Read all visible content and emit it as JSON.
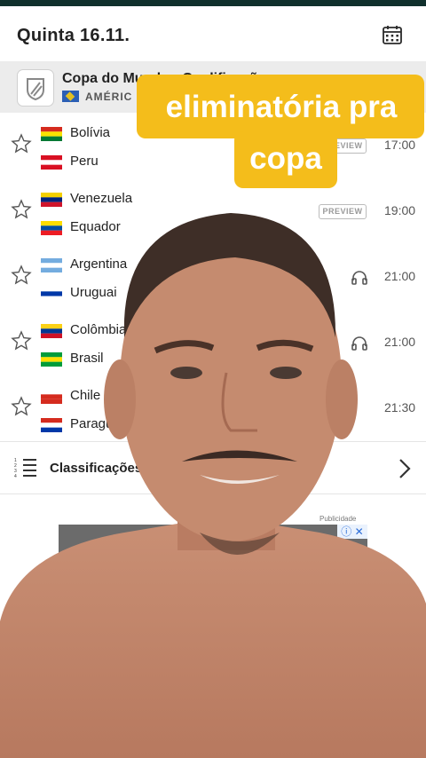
{
  "header": {
    "date": "Quinta 16.11.",
    "calendar_icon": "calendar-icon"
  },
  "competition": {
    "name": "Copa do Mundo · Qualificação",
    "region": "AMÉRIC"
  },
  "matches": [
    {
      "home": "Bolívia",
      "away": "Peru",
      "time": "17:00",
      "badge": "PREVIEW",
      "home_flag": [
        "#d52b1e",
        "#f9e300",
        "#007934"
      ],
      "away_flag": [
        "#d91023",
        "#ffffff",
        "#d91023"
      ]
    },
    {
      "home": "Venezuela",
      "away": "Equador",
      "time": "19:00",
      "badge": "PREVIEW",
      "home_flag": [
        "#f4d000",
        "#00247d",
        "#cf142b"
      ],
      "away_flag": [
        "#ffdd00",
        "#034ea2",
        "#ed1c24"
      ]
    },
    {
      "home": "Argentina",
      "away": "Uruguai",
      "time": "21:00",
      "badge": "headphones",
      "home_flag": [
        "#74acdf",
        "#ffffff",
        "#74acdf"
      ],
      "away_flag": [
        "#ffffff",
        "#0038a8",
        "#ffffff"
      ]
    },
    {
      "home": "Colômbia",
      "away": "Brasil",
      "time": "21:00",
      "badge": "headphones",
      "home_flag": [
        "#fcd116",
        "#003893",
        "#ce1126"
      ],
      "away_flag": [
        "#009c3b",
        "#ffdf00",
        "#009c3b"
      ]
    },
    {
      "home": "Chile",
      "away": "Paraguai",
      "time": "21:30",
      "badge": "",
      "home_flag": [
        "#ffffff",
        "#d52b1e",
        "#d52b1e"
      ],
      "away_flag": [
        "#d52b1e",
        "#ffffff",
        "#0038a8"
      ]
    }
  ],
  "standings": {
    "label": "Classificações"
  },
  "ad": {
    "label": "Publicidade",
    "badge": "ⓘ ✕"
  },
  "caption": {
    "line1": "eliminatória pra",
    "line2": "copa"
  },
  "colors": {
    "accent": "#f4bd1b",
    "topbar": "#10302c"
  }
}
